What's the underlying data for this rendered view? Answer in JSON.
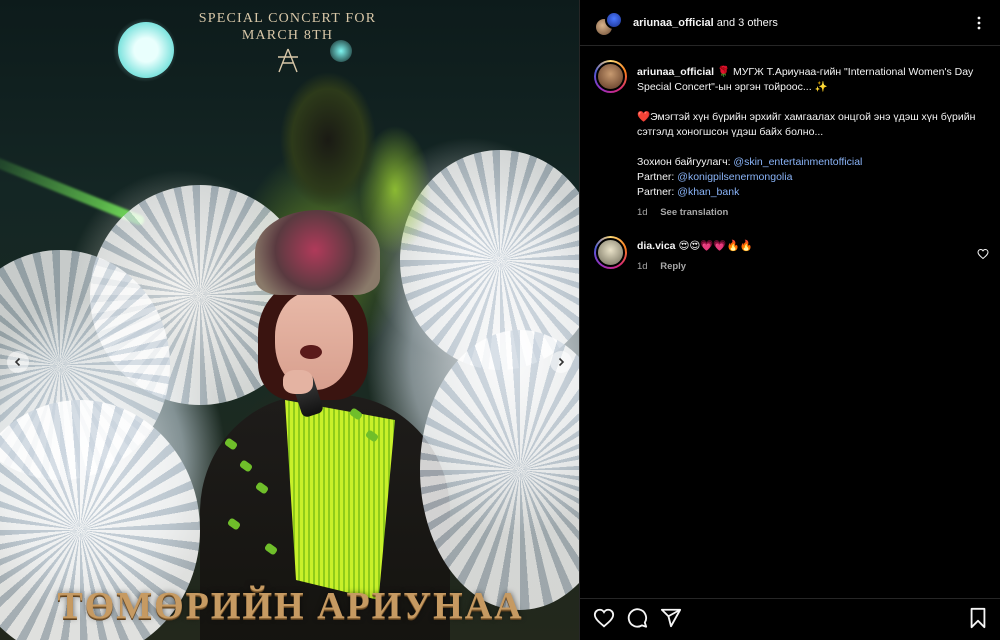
{
  "post": {
    "media": {
      "concert_title": "SPECIAL CONCERT FOR\nMARCH 8TH",
      "artist_title": "ТӨМӨРИЙН АРИУНАА",
      "prev_button": "previous-image",
      "next_button": "next-image"
    },
    "header": {
      "username": "ariunaa_official",
      "collab_suffix": " and 3 others",
      "more_icon": "more-horizontal-icon"
    },
    "caption": {
      "username": "ariunaa_official",
      "line1_emoji": "🌹",
      "line1_text": "МУГЖ Т.Ариунаа-гийн \"International Women's Day Special Concert\"-ын эргэн тойроос...",
      "line1_end_emoji": "✨",
      "line2_emoji": "❤️",
      "line2_text": "Эмэгтэй хүн бүрийн эрхийг хамгаалах онцгой энэ үдэш хүн бүрийн сэтгэлд хоногшсон үдэш байх болно...",
      "organizer_label": "Зохион байгуулагч:",
      "organizer_handle": "@skin_entertainmentofficial",
      "partner1_label": "Partner:",
      "partner1_handle": "@konigpilsenermongolia",
      "partner2_label": "Partner:",
      "partner2_handle": "@khan_bank",
      "time": "1d",
      "translate": "See translation"
    },
    "comments": [
      {
        "username": "dia.vica",
        "text": "😍😍💗💗🔥🔥",
        "time": "1d",
        "reply": "Reply"
      }
    ],
    "actions": {
      "like": "heart-icon",
      "comment": "comment-icon",
      "share": "share-icon",
      "save": "bookmark-icon"
    }
  },
  "colors": {
    "background": "#000000",
    "link": "#8ab4f8",
    "muted": "#a8a8a8",
    "title_gold": "#c69a62"
  }
}
